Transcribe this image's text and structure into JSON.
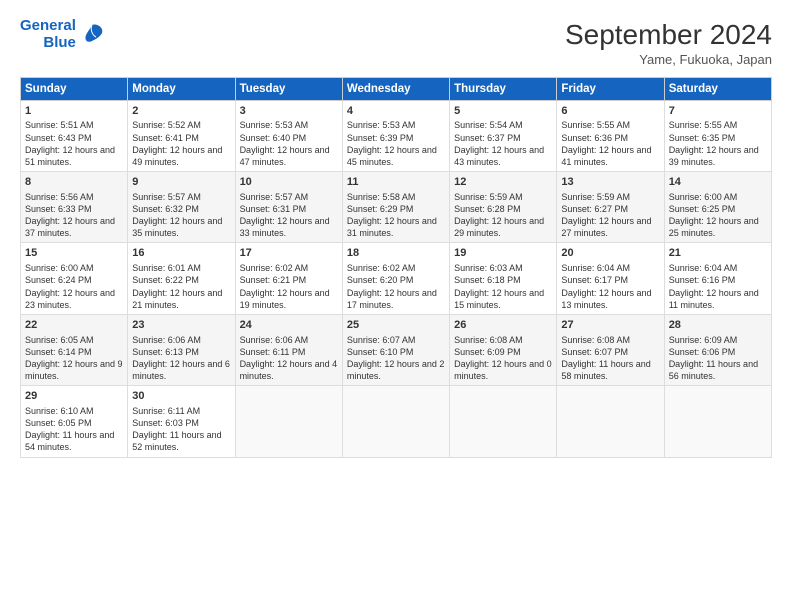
{
  "logo": {
    "line1": "General",
    "line2": "Blue"
  },
  "title": "September 2024",
  "subtitle": "Yame, Fukuoka, Japan",
  "headers": [
    "Sunday",
    "Monday",
    "Tuesday",
    "Wednesday",
    "Thursday",
    "Friday",
    "Saturday"
  ],
  "weeks": [
    [
      {
        "day": "1",
        "sunrise": "5:51 AM",
        "sunset": "6:43 PM",
        "daylight": "12 hours and 51 minutes."
      },
      {
        "day": "2",
        "sunrise": "5:52 AM",
        "sunset": "6:41 PM",
        "daylight": "12 hours and 49 minutes."
      },
      {
        "day": "3",
        "sunrise": "5:53 AM",
        "sunset": "6:40 PM",
        "daylight": "12 hours and 47 minutes."
      },
      {
        "day": "4",
        "sunrise": "5:53 AM",
        "sunset": "6:39 PM",
        "daylight": "12 hours and 45 minutes."
      },
      {
        "day": "5",
        "sunrise": "5:54 AM",
        "sunset": "6:37 PM",
        "daylight": "12 hours and 43 minutes."
      },
      {
        "day": "6",
        "sunrise": "5:55 AM",
        "sunset": "6:36 PM",
        "daylight": "12 hours and 41 minutes."
      },
      {
        "day": "7",
        "sunrise": "5:55 AM",
        "sunset": "6:35 PM",
        "daylight": "12 hours and 39 minutes."
      }
    ],
    [
      {
        "day": "8",
        "sunrise": "5:56 AM",
        "sunset": "6:33 PM",
        "daylight": "12 hours and 37 minutes."
      },
      {
        "day": "9",
        "sunrise": "5:57 AM",
        "sunset": "6:32 PM",
        "daylight": "12 hours and 35 minutes."
      },
      {
        "day": "10",
        "sunrise": "5:57 AM",
        "sunset": "6:31 PM",
        "daylight": "12 hours and 33 minutes."
      },
      {
        "day": "11",
        "sunrise": "5:58 AM",
        "sunset": "6:29 PM",
        "daylight": "12 hours and 31 minutes."
      },
      {
        "day": "12",
        "sunrise": "5:59 AM",
        "sunset": "6:28 PM",
        "daylight": "12 hours and 29 minutes."
      },
      {
        "day": "13",
        "sunrise": "5:59 AM",
        "sunset": "6:27 PM",
        "daylight": "12 hours and 27 minutes."
      },
      {
        "day": "14",
        "sunrise": "6:00 AM",
        "sunset": "6:25 PM",
        "daylight": "12 hours and 25 minutes."
      }
    ],
    [
      {
        "day": "15",
        "sunrise": "6:00 AM",
        "sunset": "6:24 PM",
        "daylight": "12 hours and 23 minutes."
      },
      {
        "day": "16",
        "sunrise": "6:01 AM",
        "sunset": "6:22 PM",
        "daylight": "12 hours and 21 minutes."
      },
      {
        "day": "17",
        "sunrise": "6:02 AM",
        "sunset": "6:21 PM",
        "daylight": "12 hours and 19 minutes."
      },
      {
        "day": "18",
        "sunrise": "6:02 AM",
        "sunset": "6:20 PM",
        "daylight": "12 hours and 17 minutes."
      },
      {
        "day": "19",
        "sunrise": "6:03 AM",
        "sunset": "6:18 PM",
        "daylight": "12 hours and 15 minutes."
      },
      {
        "day": "20",
        "sunrise": "6:04 AM",
        "sunset": "6:17 PM",
        "daylight": "12 hours and 13 minutes."
      },
      {
        "day": "21",
        "sunrise": "6:04 AM",
        "sunset": "6:16 PM",
        "daylight": "12 hours and 11 minutes."
      }
    ],
    [
      {
        "day": "22",
        "sunrise": "6:05 AM",
        "sunset": "6:14 PM",
        "daylight": "12 hours and 9 minutes."
      },
      {
        "day": "23",
        "sunrise": "6:06 AM",
        "sunset": "6:13 PM",
        "daylight": "12 hours and 6 minutes."
      },
      {
        "day": "24",
        "sunrise": "6:06 AM",
        "sunset": "6:11 PM",
        "daylight": "12 hours and 4 minutes."
      },
      {
        "day": "25",
        "sunrise": "6:07 AM",
        "sunset": "6:10 PM",
        "daylight": "12 hours and 2 minutes."
      },
      {
        "day": "26",
        "sunrise": "6:08 AM",
        "sunset": "6:09 PM",
        "daylight": "12 hours and 0 minutes."
      },
      {
        "day": "27",
        "sunrise": "6:08 AM",
        "sunset": "6:07 PM",
        "daylight": "11 hours and 58 minutes."
      },
      {
        "day": "28",
        "sunrise": "6:09 AM",
        "sunset": "6:06 PM",
        "daylight": "11 hours and 56 minutes."
      }
    ],
    [
      {
        "day": "29",
        "sunrise": "6:10 AM",
        "sunset": "6:05 PM",
        "daylight": "11 hours and 54 minutes."
      },
      {
        "day": "30",
        "sunrise": "6:11 AM",
        "sunset": "6:03 PM",
        "daylight": "11 hours and 52 minutes."
      },
      null,
      null,
      null,
      null,
      null
    ]
  ]
}
